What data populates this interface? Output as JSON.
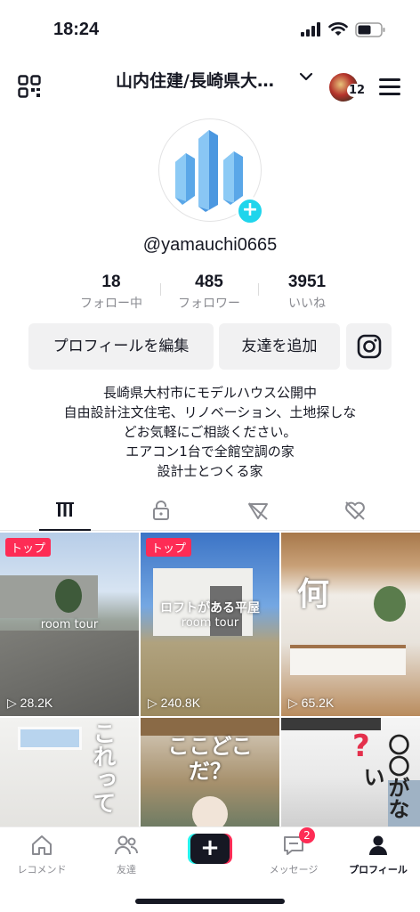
{
  "status_bar": {
    "time": "18:24"
  },
  "header": {
    "account_name": "山内住建/長崎県大…",
    "notification_count": "12"
  },
  "profile": {
    "handle": "@yamauchi0665",
    "stats": [
      {
        "value": "18",
        "label": "フォロー中"
      },
      {
        "value": "485",
        "label": "フォロワー"
      },
      {
        "value": "3951",
        "label": "いいね"
      }
    ],
    "edit_button": "プロフィールを編集",
    "add_friend_button": "友達を追加",
    "bio_lines": [
      "長崎県大村市にモデルハウス公開中",
      "自由設計注文住宅、リノベーション、土地探しな",
      "どお気軽にご相談ください。",
      "エアコン1台で全館空調の家",
      "設計士とつくる家"
    ]
  },
  "videos": [
    {
      "badge": "トップ",
      "caption": "room tour",
      "views": "28.2K"
    },
    {
      "badge": "トップ",
      "caption_title": "ロフトがある平屋",
      "caption": "room tour",
      "views": "240.8K"
    },
    {
      "caption_title": "何",
      "views": "65.2K"
    },
    {
      "caption_title": "これって"
    },
    {
      "caption_title": "ここどこだ？"
    },
    {
      "caption_title": "〇〇がない"
    }
  ],
  "bottom_nav": {
    "home": "レコメンド",
    "friends": "友達",
    "inbox": "メッセージ",
    "inbox_badge": "2",
    "profile": "プロフィール"
  },
  "colors": {
    "accent": "#fe2c55",
    "cyan": "#25f4ee",
    "badge_blue": "#20d5ec"
  }
}
